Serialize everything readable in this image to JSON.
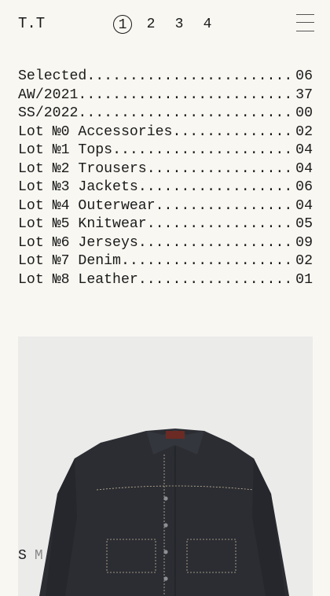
{
  "header": {
    "brand": "T.T",
    "pages": [
      "1",
      "2",
      "3",
      "4"
    ],
    "active_page": "1"
  },
  "index": [
    {
      "label": "Selected",
      "count": "06"
    },
    {
      "label": "AW/2021",
      "count": "37"
    },
    {
      "label": "SS/2022",
      "count": "00"
    },
    {
      "label": "Lot №0 Accessories",
      "count": "02"
    },
    {
      "label": "Lot №1 Tops",
      "count": "04"
    },
    {
      "label": "Lot №2 Trousers",
      "count": "04"
    },
    {
      "label": "Lot №3 Jackets",
      "count": "06"
    },
    {
      "label": "Lot №4 Outerwear",
      "count": "04"
    },
    {
      "label": "Lot №5 Knitwear",
      "count": "05"
    },
    {
      "label": "Lot №6 Jerseys",
      "count": "09"
    },
    {
      "label": "Lot №7 Denim",
      "count": "02"
    },
    {
      "label": "Lot №8 Leather",
      "count": "01"
    }
  ],
  "product": {
    "image": "denim-jacket-image",
    "sizes": [
      "S",
      "M"
    ]
  },
  "colors": {
    "background": "#f8f7f2",
    "text": "#1a1a1a",
    "image_bg": "#ebebea",
    "denim": "#2b2d33"
  }
}
